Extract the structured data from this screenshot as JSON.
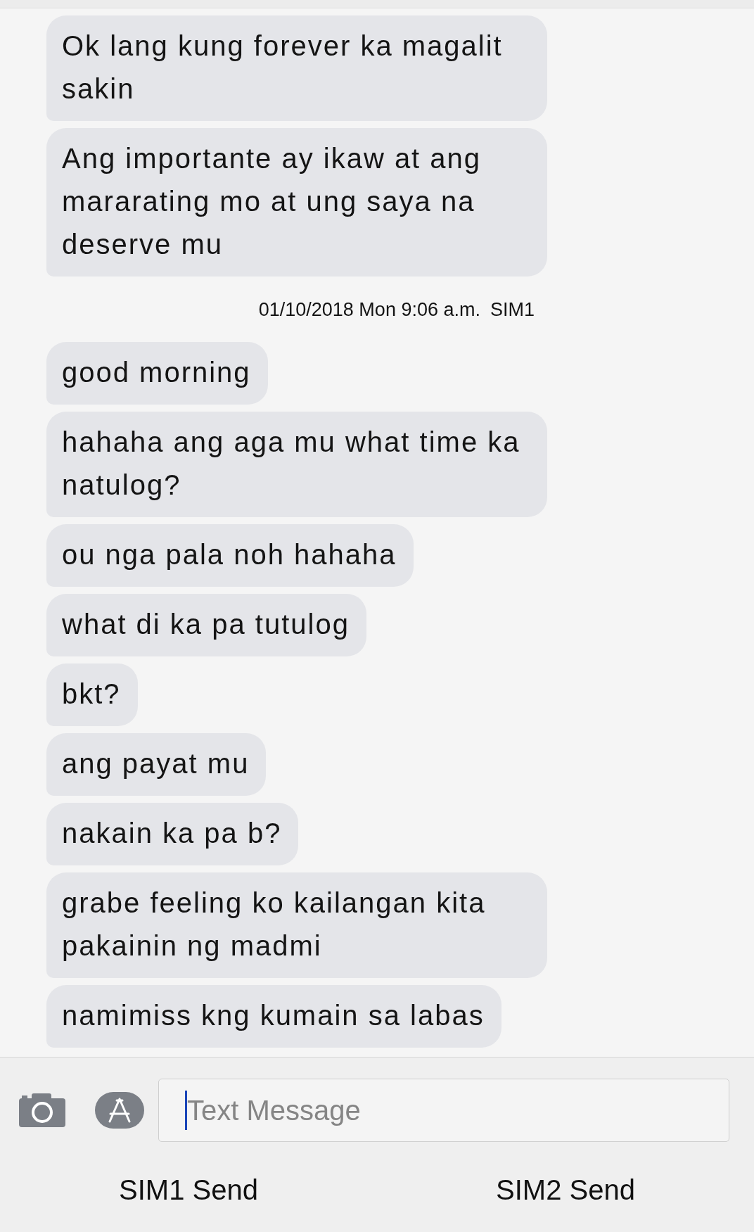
{
  "messages": [
    {
      "kind": "received",
      "text": "Ok lang kung forever ka magalit sakin"
    },
    {
      "kind": "received",
      "text": "Ang importante ay ikaw at ang mararating mo at ung saya na deserve mu"
    },
    {
      "kind": "timestamp",
      "time": "01/10/2018 Mon 9:06 a.m.",
      "sim": "SIM1"
    },
    {
      "kind": "received",
      "text": "good morning"
    },
    {
      "kind": "received",
      "text": "hahaha ang aga mu what time ka natulog?"
    },
    {
      "kind": "received",
      "text": "ou nga pala noh hahaha"
    },
    {
      "kind": "received",
      "text": "what di ka pa tutulog"
    },
    {
      "kind": "received",
      "text": "bkt?"
    },
    {
      "kind": "received",
      "text": "ang payat mu"
    },
    {
      "kind": "received",
      "text": "nakain ka pa b?"
    },
    {
      "kind": "received",
      "text": "grabe feeling ko kailangan kita pakainin ng madmi"
    },
    {
      "kind": "received",
      "text": "namimiss kng kumain sa labas"
    }
  ],
  "composer": {
    "placeholder": "Text Message",
    "focused": true
  },
  "send_buttons": [
    "SIM1 Send",
    "SIM2 Send"
  ]
}
